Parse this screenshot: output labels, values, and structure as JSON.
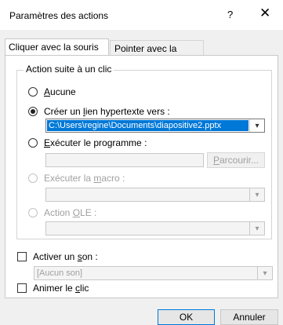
{
  "window": {
    "title": "Paramètres des actions",
    "help": "?",
    "close": "✕"
  },
  "tabs": [
    {
      "label": "Cliquer avec la souris",
      "active": true
    },
    {
      "label": "Pointer avec la souris",
      "active": false
    }
  ],
  "group": {
    "legend": "Action suite à un clic"
  },
  "options": {
    "none": {
      "pre": "",
      "u": "A",
      "post": "ucune",
      "checked": false,
      "enabled": true
    },
    "hyperlink": {
      "pre": "Créer un ",
      "u": "l",
      "post": "ien hypertexte vers :",
      "checked": true,
      "enabled": true,
      "value": "C:\\Users\\regine\\Documents\\diapositive2.pptx"
    },
    "program": {
      "pre": "",
      "u": "E",
      "post": "xécuter le programme :",
      "checked": false,
      "enabled": true,
      "value": "",
      "browse_pre": "",
      "browse_u": "P",
      "browse_post": "arcourir..."
    },
    "macro": {
      "pre": "Exécuter la ",
      "u": "m",
      "post": "acro :",
      "checked": false,
      "enabled": false
    },
    "ole": {
      "pre": "Action ",
      "u": "O",
      "post": "LE :",
      "checked": false,
      "enabled": false
    }
  },
  "sound": {
    "pre": "Activer un ",
    "u": "s",
    "post": "on :",
    "checked": false,
    "value": "[Aucun son]"
  },
  "highlight": {
    "pre": "Animer le ",
    "u": "c",
    "post": "lic",
    "checked": false
  },
  "buttons": {
    "ok": "OK",
    "cancel": "Annuler"
  },
  "colors": {
    "accent": "#0078d7",
    "disabled_text": "#a0a0a0"
  }
}
